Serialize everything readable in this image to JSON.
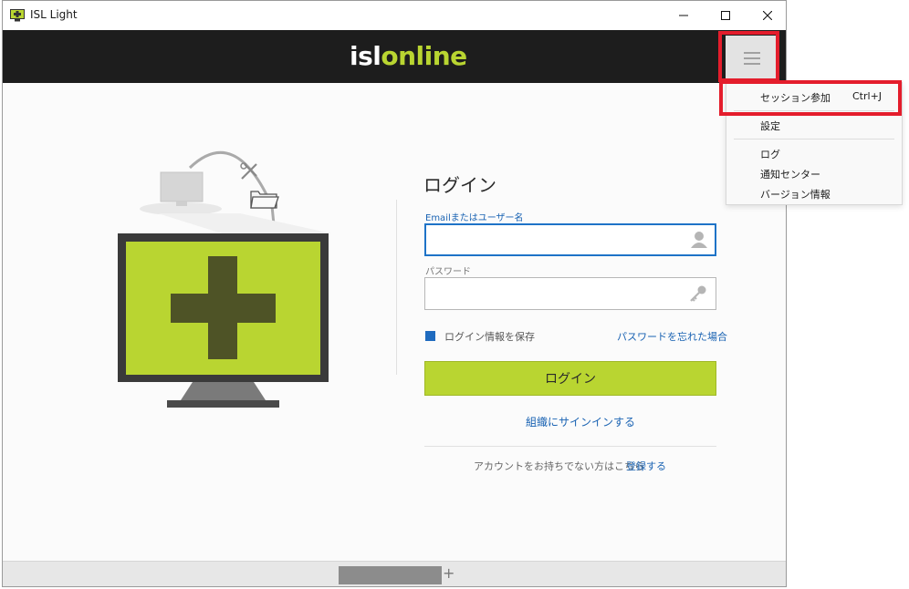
{
  "window": {
    "title": "ISL Light",
    "app_icon": "isl-light-app-icon",
    "controls": [
      "minimize-icon",
      "maximize-icon",
      "close-icon"
    ]
  },
  "header": {
    "logo_isl": "isl",
    "logo_online": "online",
    "menu_icon": "hamburger-menu-icon"
  },
  "menu": {
    "items": [
      {
        "label": "セッション参加",
        "shortcut": "Ctrl+J"
      },
      {
        "label": "設定"
      },
      {
        "label": "ログ"
      },
      {
        "label": "通知センター"
      },
      {
        "label": "バージョン情報"
      }
    ]
  },
  "login": {
    "title": "ログイン",
    "email_label": "Emailまたはユーザー名",
    "email_value": "",
    "password_label": "パスワード",
    "password_value": "",
    "remember_label": "ログイン情報を保存",
    "remember_checked": true,
    "forgot_link": "パスワードを忘れた場合",
    "login_button": "ログイン",
    "org_signin_link": "組織にサインインする",
    "no_account_text": "アカウントをお持ちでない方はこちら",
    "register_link": "登録する"
  },
  "colors": {
    "accent_green": "#b9d531",
    "header_bg": "#1d1d1d",
    "link_blue": "#1a63b3",
    "highlight_red": "#e41d2c"
  }
}
